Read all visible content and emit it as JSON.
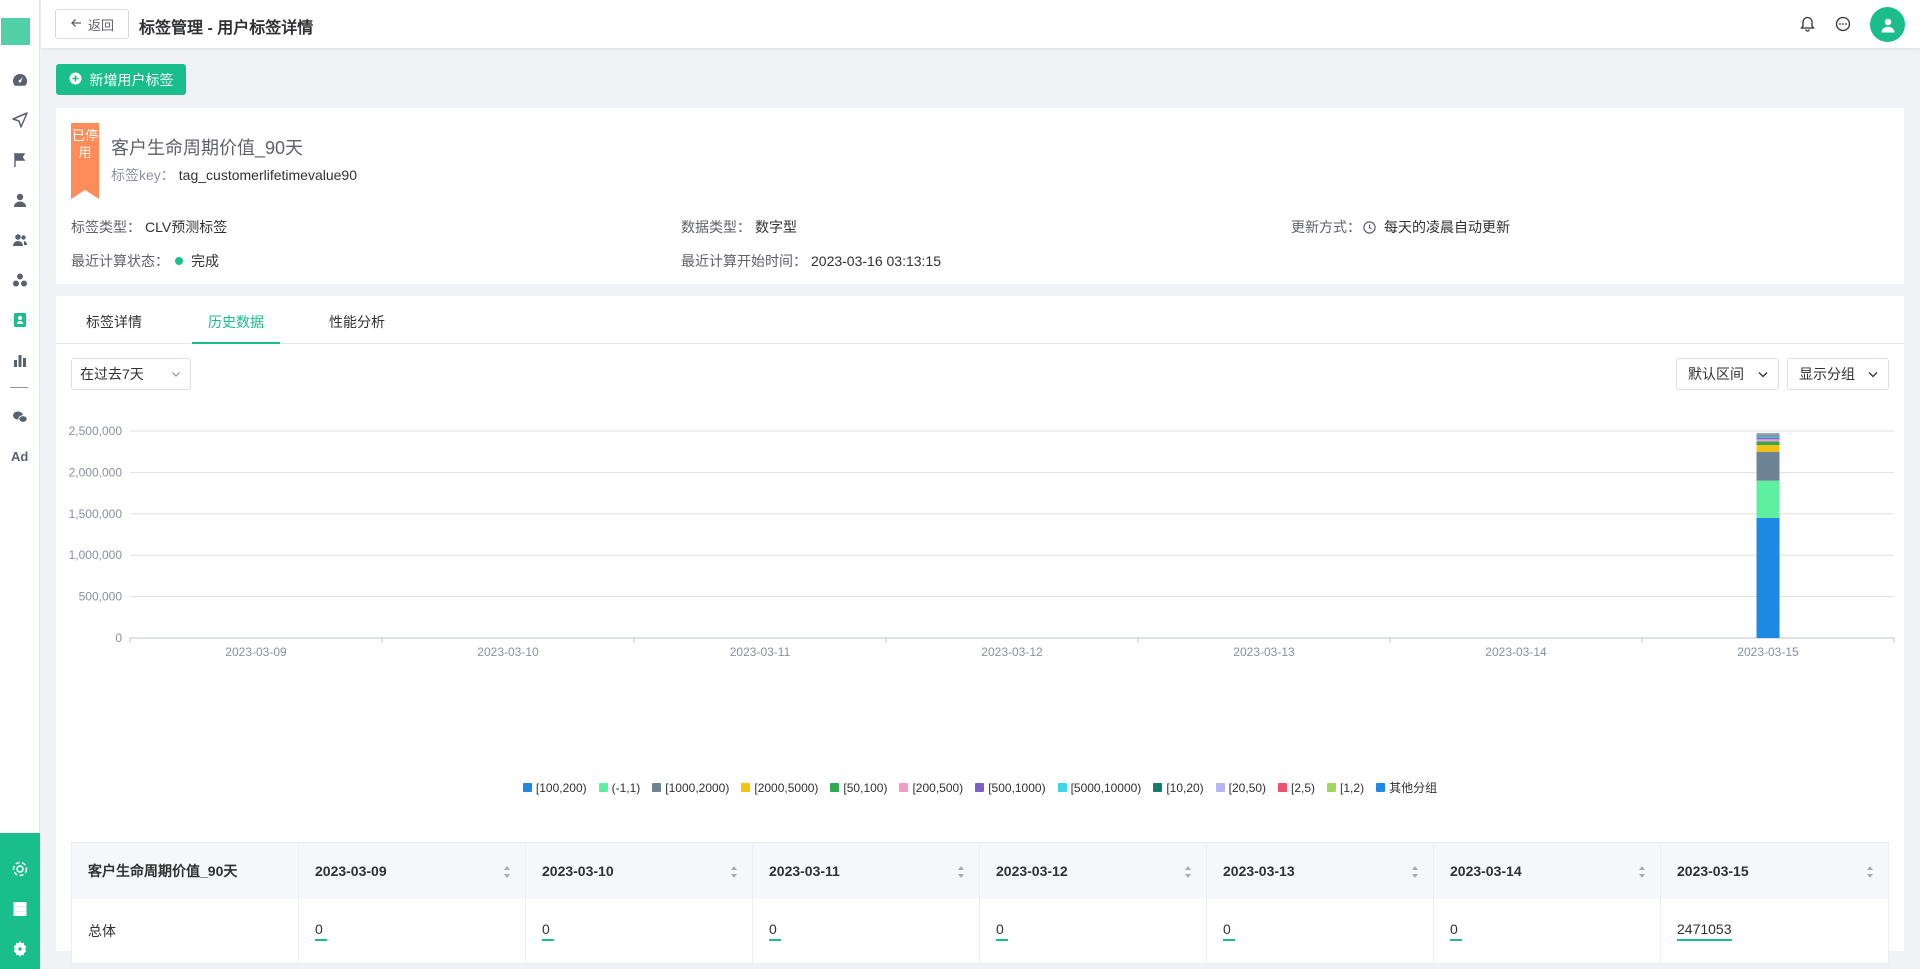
{
  "header": {
    "back_label": "返回",
    "title": "标签管理 - 用户标签详情"
  },
  "toolbar": {
    "add_label": "新增用户标签"
  },
  "tag": {
    "status_badge": "已停用",
    "name": "客户生命周期价值_90天",
    "key_label": "标签key：",
    "key_value": "tag_customerlifetimevalue90",
    "type_label": "标签类型：",
    "type_value": "CLV预测标签",
    "data_type_label": "数据类型：",
    "data_type_value": "数字型",
    "update_label": "更新方式：",
    "update_value": "每天的凌晨自动更新",
    "calc_status_label": "最近计算状态：",
    "calc_status_value": "完成",
    "calc_time_label": "最近计算开始时间：",
    "calc_time_value": "2023-03-16 03:13:15"
  },
  "tabs": [
    "标签详情",
    "历史数据",
    "性能分析"
  ],
  "active_tab": 1,
  "filters": {
    "range": "在过去7天",
    "interval": "默认区间",
    "group": "显示分组"
  },
  "chart_data": {
    "type": "bar",
    "stacked": true,
    "categories": [
      "2023-03-09",
      "2023-03-10",
      "2023-03-11",
      "2023-03-12",
      "2023-03-13",
      "2023-03-14",
      "2023-03-15"
    ],
    "y_ticks": [
      "0",
      "500,000",
      "1,000,000",
      "1,500,000",
      "2,000,000",
      "2,500,000"
    ],
    "ylim": [
      0,
      2500000
    ],
    "grid": true,
    "legend_position": "bottom",
    "series": [
      {
        "name": "[100,200)",
        "color": "#1e88e5",
        "values": [
          0,
          0,
          0,
          0,
          0,
          0,
          1450000
        ]
      },
      {
        "name": "(-1,1)",
        "color": "#5ef0a0",
        "values": [
          0,
          0,
          0,
          0,
          0,
          0,
          450000
        ]
      },
      {
        "name": "[1000,2000)",
        "color": "#6e8494",
        "values": [
          0,
          0,
          0,
          0,
          0,
          0,
          350000
        ]
      },
      {
        "name": "[2000,5000)",
        "color": "#f7c20e",
        "values": [
          0,
          0,
          0,
          0,
          0,
          0,
          80000
        ]
      },
      {
        "name": "[50,100)",
        "color": "#2fa84f",
        "values": [
          0,
          0,
          0,
          0,
          0,
          0,
          45000
        ]
      },
      {
        "name": "[200,500)",
        "color": "#f59ac8",
        "values": [
          0,
          0,
          0,
          0,
          0,
          0,
          25000
        ]
      },
      {
        "name": "[500,1000)",
        "color": "#7e5fc9",
        "values": [
          0,
          0,
          0,
          0,
          0,
          0,
          20000
        ]
      },
      {
        "name": "[5000,10000)",
        "color": "#3dd5e8",
        "values": [
          0,
          0,
          0,
          0,
          0,
          0,
          15000
        ]
      },
      {
        "name": "[10,20)",
        "color": "#167a6e",
        "values": [
          0,
          0,
          0,
          0,
          0,
          0,
          12000
        ]
      },
      {
        "name": "[20,50)",
        "color": "#b9b4f5",
        "values": [
          0,
          0,
          0,
          0,
          0,
          0,
          10000
        ]
      },
      {
        "name": "[2,5)",
        "color": "#f0506e",
        "values": [
          0,
          0,
          0,
          0,
          0,
          0,
          8000
        ]
      },
      {
        "name": "[1,2)",
        "color": "#9fd85a",
        "values": [
          0,
          0,
          0,
          0,
          0,
          0,
          6000
        ]
      },
      {
        "name": "其他分组",
        "color": "#1e88e5",
        "values": [
          0,
          0,
          0,
          0,
          0,
          0,
          5053
        ]
      }
    ]
  },
  "table": {
    "first_header": "客户生命周期价值_90天",
    "row_label": "总体",
    "columns": [
      "2023-03-09",
      "2023-03-10",
      "2023-03-11",
      "2023-03-12",
      "2023-03-13",
      "2023-03-14",
      "2023-03-15"
    ],
    "values": [
      "0",
      "0",
      "0",
      "0",
      "0",
      "0",
      "2471053"
    ]
  },
  "colors": {
    "accent": "#19be8b",
    "ribbon": "#ff8c5a"
  },
  "icons": {
    "sidebar": [
      "dashboard-icon",
      "send-icon",
      "flag-icon",
      "user-icon",
      "users-icon",
      "segment-icon",
      "tag-icon",
      "chart-icon",
      "wechat-icon",
      "ad-icon"
    ],
    "sidebar_bottom": [
      "cluster-icon",
      "server-icon",
      "settings-icon"
    ]
  }
}
